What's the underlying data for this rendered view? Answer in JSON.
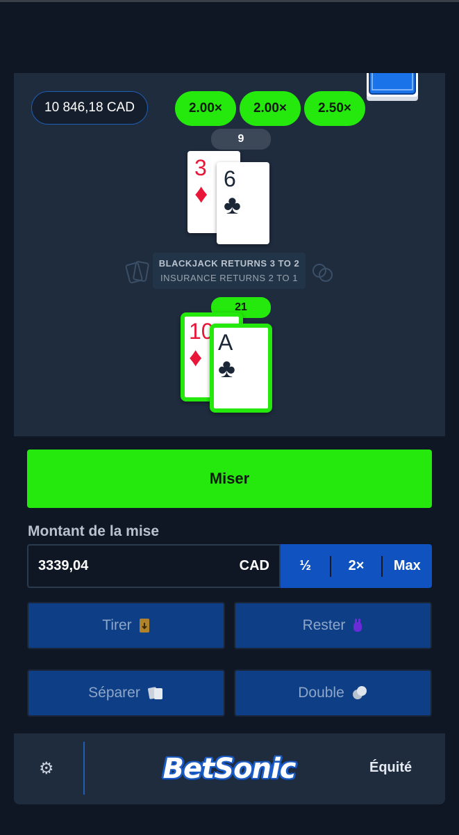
{
  "header": {},
  "game": {
    "balance": "10 846,18 CAD",
    "multipliers": [
      "2.00×",
      "2.00×",
      "2.50×"
    ],
    "dealer": {
      "score": "9",
      "cards": [
        {
          "rank": "3",
          "suit": "♦",
          "color": "red"
        },
        {
          "rank": "6",
          "suit": "♣",
          "color": "dark"
        }
      ]
    },
    "player": {
      "score": "21",
      "cards": [
        {
          "rank": "10",
          "suit": "♦",
          "color": "red"
        },
        {
          "rank": "A",
          "suit": "♣",
          "color": "dark"
        }
      ]
    },
    "rules": {
      "line1": "BLACKJACK RETURNS 3 TO 2",
      "line2": "INSURANCE RETURNS 2 TO 1"
    }
  },
  "controls": {
    "bet_label": "Miser",
    "amount_label": "Montant de la mise",
    "amount_value": "3339,04",
    "currency": "CAD",
    "quick": [
      "½",
      "2×",
      "Max"
    ],
    "actions": {
      "hit": "Tirer",
      "stand": "Rester",
      "split": "Séparer",
      "double": "Double"
    }
  },
  "footer": {
    "logo_text": "BetSonic",
    "equity_label": "Équité",
    "settings_icon": "gear-icon"
  },
  "colors": {
    "accent_green": "#25e90c",
    "accent_blue": "#1053c0",
    "panel": "#1f2c3e",
    "background": "#0f1724"
  }
}
